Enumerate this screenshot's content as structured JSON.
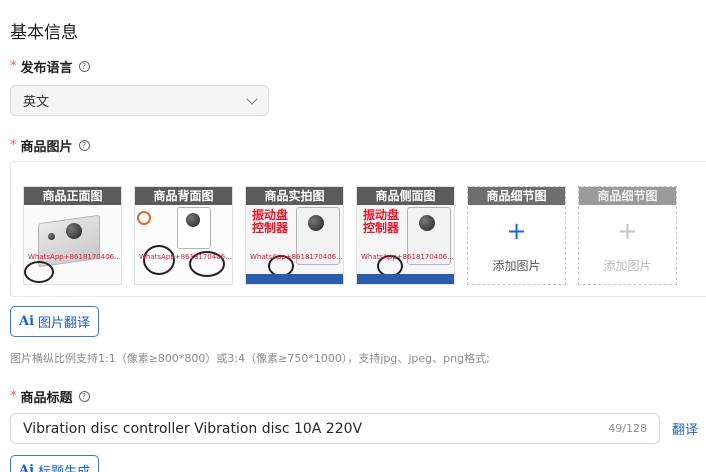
{
  "section": {
    "title": "基本信息"
  },
  "language": {
    "label": "发布语言",
    "required_mark": "*",
    "help": "?",
    "selected": "英文"
  },
  "images": {
    "label": "商品图片",
    "required_mark": "*",
    "help": "?",
    "slots": [
      {
        "header": "商品正面图",
        "filled": true
      },
      {
        "header": "商品背面图",
        "filled": true
      },
      {
        "header": "商品实拍图",
        "filled": true,
        "promo": "振动盘控制器"
      },
      {
        "header": "商品侧面图",
        "filled": true,
        "promo": "振动盘控制器"
      },
      {
        "header": "商品细节图",
        "filled": false,
        "add_text": "添加图片",
        "plus": "+"
      },
      {
        "header": "商品细节图",
        "filled": false,
        "add_text": "添加图片",
        "plus": "+",
        "disabled": true
      }
    ],
    "watermark": "WhatsApp+8618170406...",
    "translate_button": {
      "icon": "Ai",
      "label": "图片翻译"
    },
    "hint": "图片横纵比例支持1:1（像素≥800*800）或3:4（像素≥750*1000），支持jpg、jpeg、png格式;"
  },
  "product_title": {
    "label": "商品标题",
    "required_mark": "*",
    "help": "?",
    "value": "Vibration disc controller Vibration disc 10A 220V",
    "counter": "49/128",
    "translate_link": "翻译",
    "generate_button": {
      "icon": "Ai",
      "label": "标题生成"
    }
  },
  "colors": {
    "accent": "#1a66d9",
    "required": "#ff4d4f",
    "promo_red": "#e8182c"
  }
}
